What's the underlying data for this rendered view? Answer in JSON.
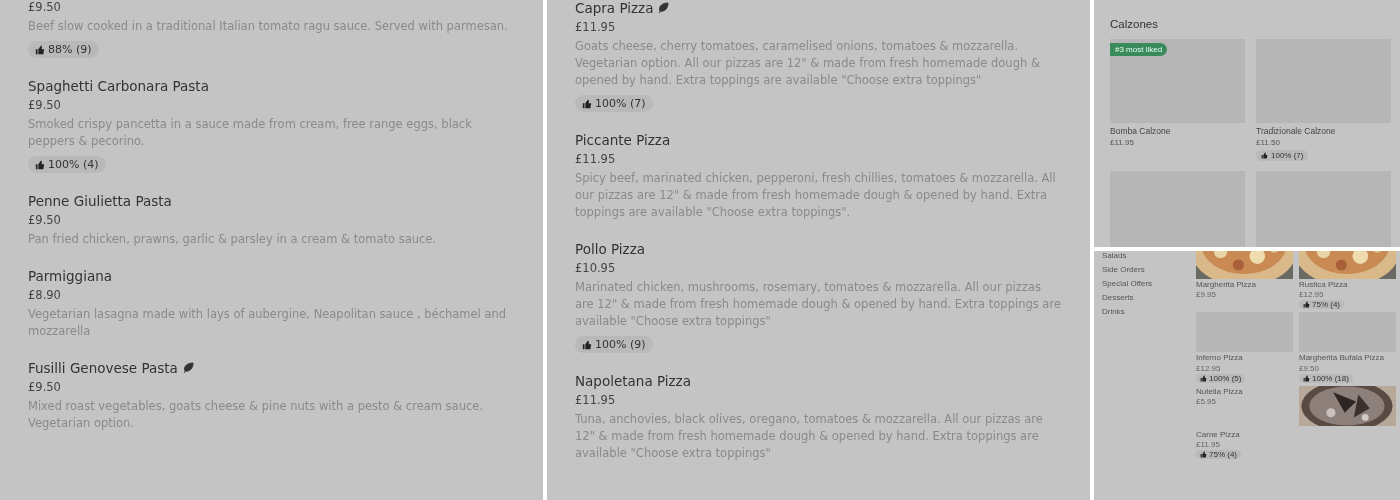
{
  "panels": [
    {
      "kind": "list",
      "items": [
        {
          "price": "£9.50",
          "description": "Beef slow cooked in a traditional Italian tomato ragu sauce. Served with parmesan.",
          "vegetarian": false,
          "rating": "88% (9)"
        },
        {
          "name": "Spaghetti Carbonara Pasta",
          "price": "£9.50",
          "description": "Smoked crispy pancetta in a sauce made from cream, free range eggs, black peppers & pecorino.",
          "vegetarian": false,
          "rating": "100% (4)"
        },
        {
          "name": "Penne Giulietta Pasta",
          "price": "£9.50",
          "description": "Pan fried chicken, prawns, garlic & parsley in a cream & tomato sauce.",
          "vegetarian": false
        },
        {
          "name": "Parmiggiana",
          "price": "£8.90",
          "description": "Vegetarian lasagna made with lays of aubergine, Neapolitan sauce , béchamel and mozzarella",
          "vegetarian": false
        },
        {
          "name": "Fusilli Genovese Pasta",
          "price": "£9.50",
          "description": "Mixed roast vegetables, goats cheese & pine nuts with a pesto & cream sauce. Vegetarian option.",
          "vegetarian": true
        }
      ]
    },
    {
      "kind": "list",
      "items": [
        {
          "name": "Capra Pizza",
          "price": "£11.95",
          "description": "Goats cheese, cherry tomatoes, caramelised onions, tomatoes & mozzarella. Vegetarian option. All our pizzas are 12\" & made from fresh homemade dough & opened by hand. Extra toppings are available \"Choose extra toppings\"",
          "vegetarian": true,
          "rating": "100% (7)"
        },
        {
          "name": "Piccante Pizza",
          "price": "£11.95",
          "description": "Spicy beef, marinated chicken, pepperoni, fresh chillies, tomatoes & mozzarella. All our pizzas are 12\" & made from fresh homemade dough & opened by hand. Extra toppings are available \"Choose extra toppings\".",
          "vegetarian": false
        },
        {
          "name": "Pollo Pizza",
          "price": "£10.95",
          "description": "Marinated chicken, mushrooms, rosemary, tomatoes & mozzarella. All our pizzas are 12\" & made from fresh homemade dough & opened by hand. Extra toppings are available \"Choose extra toppings\"",
          "vegetarian": false,
          "rating": "100% (9)"
        },
        {
          "name": "Napoletana Pizza",
          "price": "£11.95",
          "description": "Tuna, anchovies, black olives, oregano, tomatoes & mozzarella. All our pizzas are 12\" & made from fresh homemade dough & opened by hand. Extra toppings are available \"Choose extra toppings\"",
          "vegetarian": false
        }
      ]
    },
    {
      "kind": "grid",
      "heading": "Calzones",
      "cards": [
        {
          "kind": "named",
          "name": "Bomba Calzone",
          "price": "£11.95",
          "badge": "#3 most liked"
        },
        {
          "kind": "named",
          "name": "Tradizionale Calzone",
          "price": "£11.50",
          "rating": "100% (7)"
        },
        {
          "kind": "blank"
        },
        {
          "kind": "blank"
        }
      ]
    },
    {
      "kind": "sidebar_grid",
      "sidebar": [
        "Salads",
        "Side Orders",
        "Special Offers",
        "Desserts",
        "Drinks"
      ],
      "cards": [
        {
          "kind": "tile_photo",
          "name": "Margherita Pizza",
          "price": "£9.95"
        },
        {
          "kind": "tile_photo",
          "name": "Rustica Pizza",
          "price": "£12.95",
          "rating": "75% (4)"
        },
        {
          "kind": "tile_blank",
          "name": "Inferno Pizza",
          "price": "£12.95",
          "rating": "100% (5)"
        },
        {
          "kind": "tile_blank",
          "name": "Margherita Bufala Pizza",
          "price": "£9.50",
          "rating": "100% (18)"
        },
        {
          "kind": "row_photo",
          "name": "Nutella Pizza",
          "price": "£5.95"
        },
        {
          "kind": "row",
          "name": "Carne Pizza",
          "price": "£11.95",
          "rating": "75% (4)"
        }
      ]
    }
  ]
}
